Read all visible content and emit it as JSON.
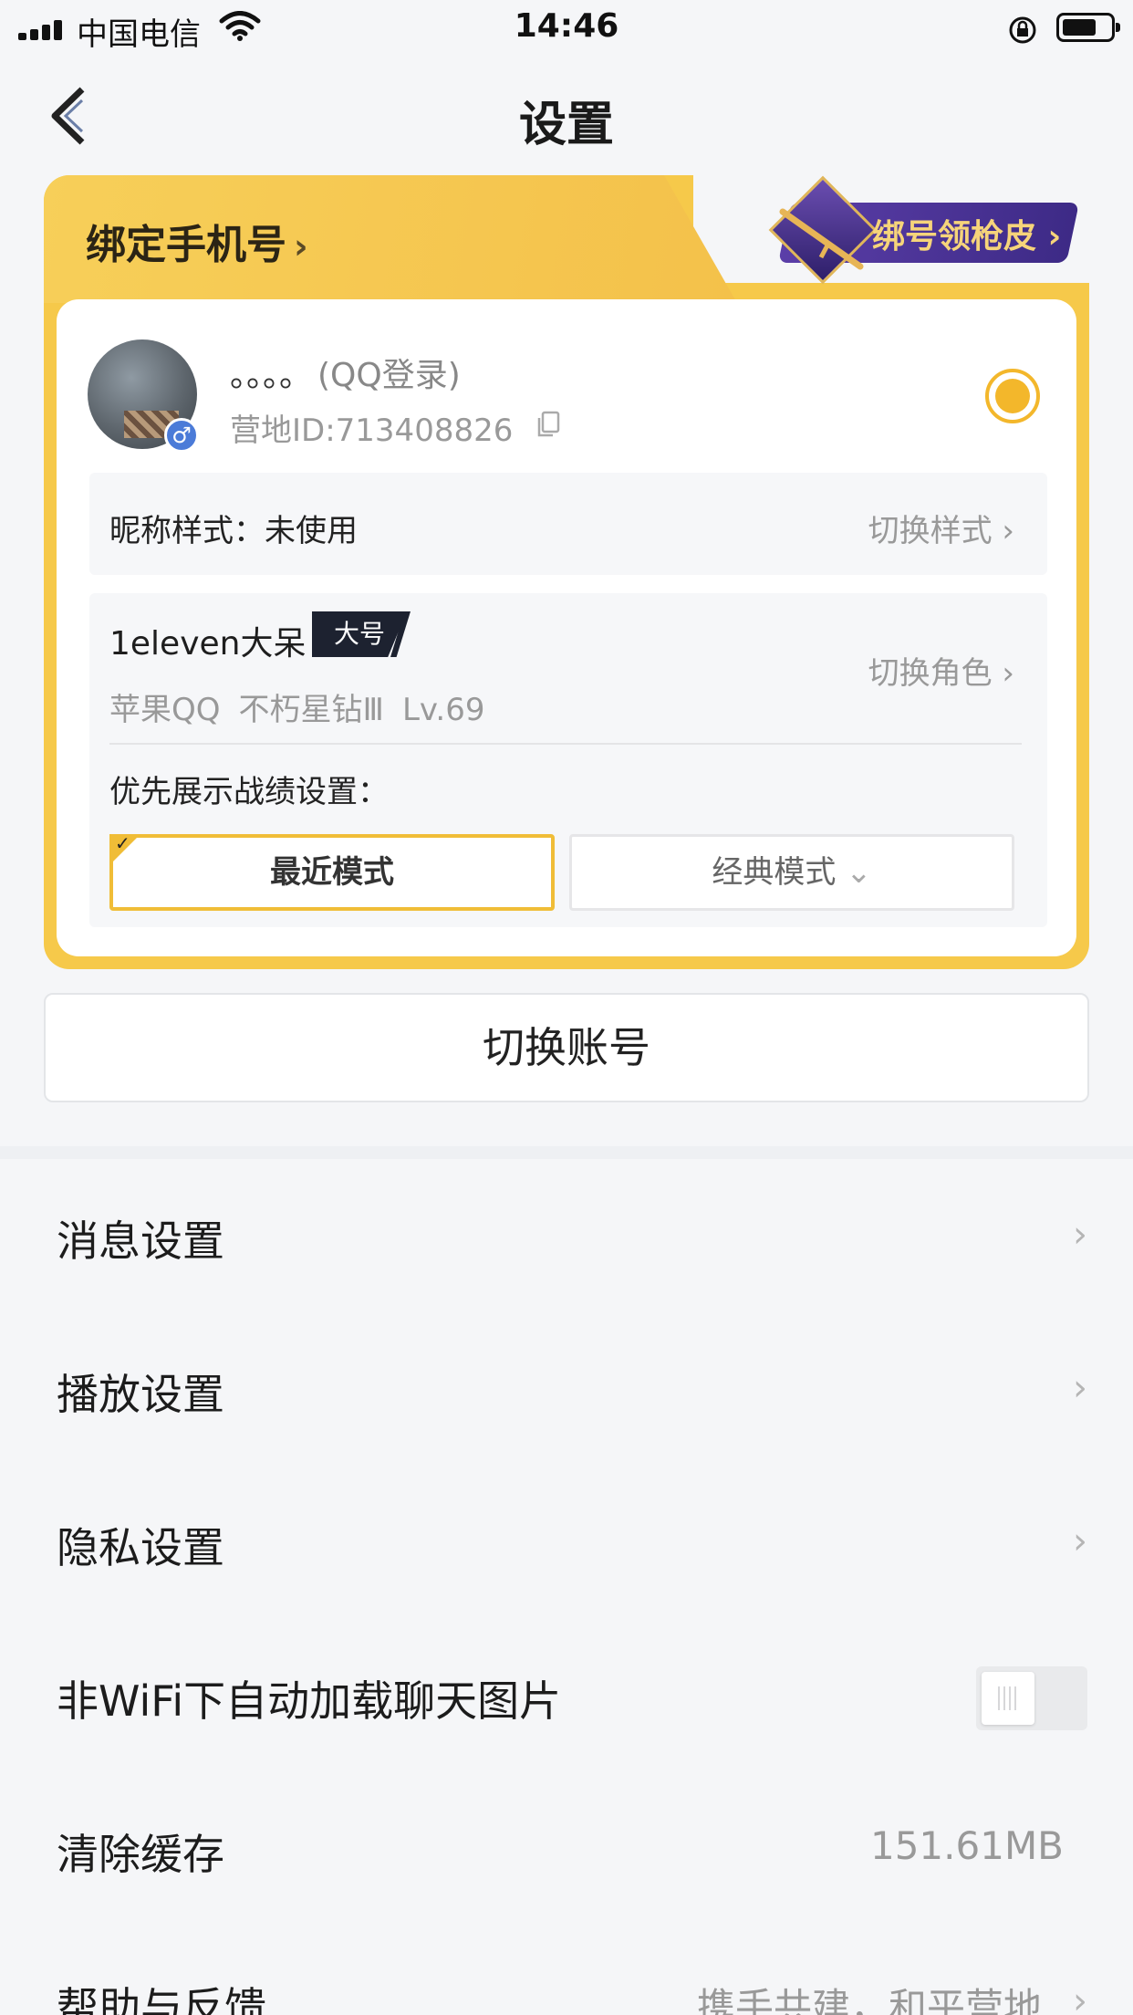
{
  "status_bar": {
    "carrier": "中国电信",
    "time": "14:46"
  },
  "nav": {
    "title": "设置"
  },
  "account_card": {
    "bind_phone": "绑定手机号",
    "skin_promo": "绑号领枪皮",
    "nickname": "。。。。",
    "login_type": "(QQ登录)",
    "camp_id": "营地ID:713408826",
    "gender_symbol": "♂",
    "nick_style_label": "昵称样式：未使用",
    "nick_style_action": "切换样式",
    "role_name": "1eleven大呆",
    "role_tag": "大号",
    "role_platform": "苹果QQ",
    "role_rank": "不朽星钻Ⅲ",
    "role_level": "Lv.69",
    "role_action": "切换角色",
    "pref_label": "优先展示战绩设置：",
    "mode_recent": "最近模式",
    "mode_classic": "经典模式",
    "accent_color": "#f3b72b"
  },
  "switch_account": "切换账号",
  "settings": {
    "message": "消息设置",
    "playback": "播放设置",
    "privacy": "隐私设置",
    "auto_load_images": "非WiFi下自动加载聊天图片",
    "auto_load_images_enabled": false,
    "clear_cache": "清除缓存",
    "cache_size": "151.61MB",
    "help": "帮助与反馈",
    "help_hint": "携手共建，和平营地"
  }
}
